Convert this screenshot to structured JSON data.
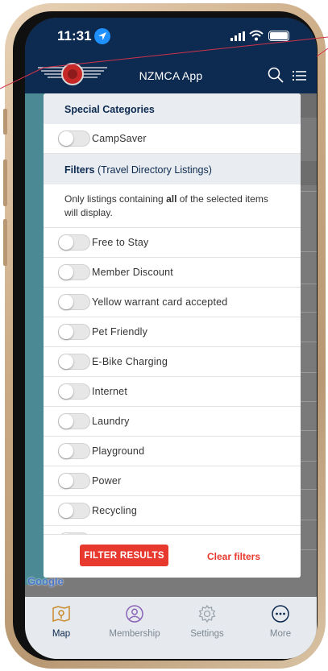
{
  "status_bar": {
    "time": "11:31"
  },
  "header": {
    "title": "NZMCA App"
  },
  "modal": {
    "special_categories": {
      "title": "Special Categories",
      "items": [
        {
          "label": "CampSaver",
          "enabled": false
        }
      ]
    },
    "filters": {
      "title": "Filters",
      "subtitle": "(Travel Directory Listings)",
      "info_prefix": "Only listings containing ",
      "info_bold": "all",
      "info_suffix": " of the selected items will display.",
      "items": [
        {
          "label": "Free to Stay",
          "enabled": false
        },
        {
          "label": "Member Discount",
          "enabled": false
        },
        {
          "label": "Yellow warrant card accepted",
          "enabled": false
        },
        {
          "label": "Pet Friendly",
          "enabled": false
        },
        {
          "label": "E-Bike Charging",
          "enabled": false
        },
        {
          "label": "Internet",
          "enabled": false
        },
        {
          "label": "Laundry",
          "enabled": false
        },
        {
          "label": "Playground",
          "enabled": false
        },
        {
          "label": "Power",
          "enabled": false
        },
        {
          "label": "Recycling",
          "enabled": false
        },
        {
          "label": "",
          "enabled": false
        }
      ]
    },
    "filter_button": "FILTER RESULTS",
    "clear_link": "Clear filters"
  },
  "map": {
    "attribution": "Google"
  },
  "tabbar": {
    "tabs": [
      {
        "label": "Map",
        "icon": "map-icon",
        "active": true
      },
      {
        "label": "Membership",
        "icon": "membership-icon",
        "active": false
      },
      {
        "label": "Settings",
        "icon": "settings-icon",
        "active": false
      },
      {
        "label": "More",
        "icon": "more-icon",
        "active": false
      }
    ]
  },
  "colors": {
    "header": "#0d2a50",
    "accent": "#e8392f",
    "section_bg": "#e9edf1",
    "tabbar_bg": "#e6eaee"
  }
}
